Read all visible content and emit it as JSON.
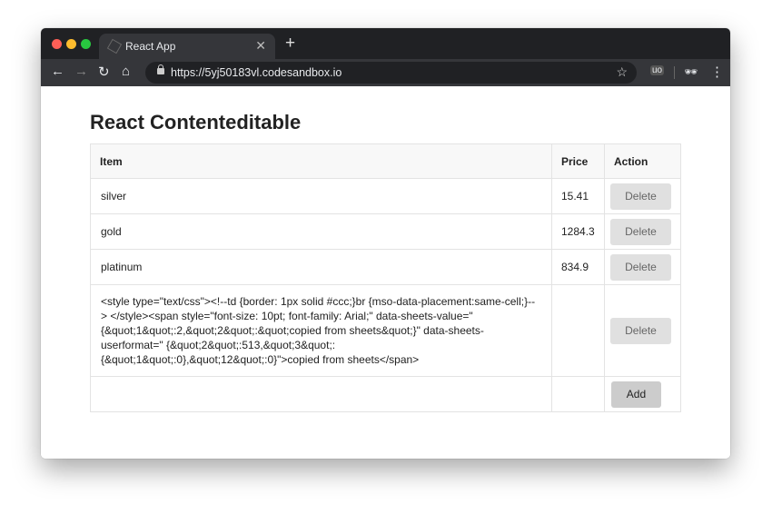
{
  "browser": {
    "tab_title": "React App",
    "url": "https://5yj50183vl.codesandbox.io",
    "icons": [
      "back-icon",
      "forward-icon",
      "reload-icon",
      "home-icon",
      "lock-icon",
      "star-icon",
      "ublock-icon",
      "incognito-icon",
      "menu-icon"
    ]
  },
  "page": {
    "title": "React Contenteditable",
    "headers": {
      "item": "Item",
      "price": "Price",
      "action": "Action"
    },
    "rows": [
      {
        "item": "silver",
        "price": "15.41",
        "action": "Delete"
      },
      {
        "item": "gold",
        "price": "1284.3",
        "action": "Delete"
      },
      {
        "item": "platinum",
        "price": "834.9",
        "action": "Delete"
      },
      {
        "item": "<style type=\"text/css\"><!--td {border: 1px solid #ccc;}br {mso-data-placement:same-cell;}--> </style><span style=\"font-size: 10pt; font-family: Arial;\" data-sheets-value=\" {&quot;1&quot;:2,&quot;2&quot;:&quot;copied from sheets&quot;}\" data-sheets-userformat=\" {&quot;2&quot;:513,&quot;3&quot;:{&quot;1&quot;:0},&quot;12&quot;:0}\">copied from sheets</span>",
        "price": "",
        "action": "Delete"
      }
    ],
    "add_label": "Add"
  }
}
